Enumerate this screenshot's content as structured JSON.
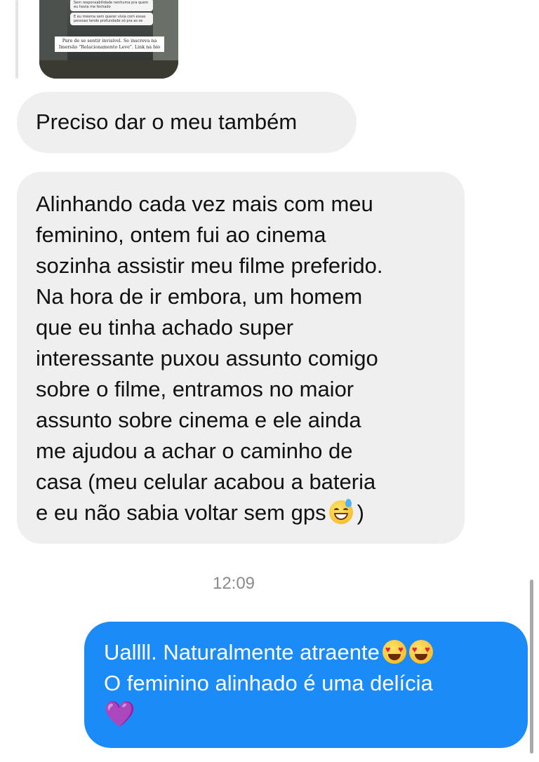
{
  "reply_preview": {
    "story_text_1": "Sem responsabilidade nenhuma pra quem eu havia me fechado",
    "story_text_2": "E eu mesma sem querer vivia com essas pessoas tendo profundade só pra as se",
    "caption": "Pare de se sentir invisível. Se inscreva na Imersão \"Relacionamento Leve\". Link na bio"
  },
  "messages": [
    {
      "sender": "them",
      "text": "Preciso dar o meu também"
    },
    {
      "sender": "them",
      "lines": [
        "Alinhando cada vez mais com meu",
        "feminino, ontem fui ao cinema",
        "sozinha assistir meu filme preferido.",
        "Na hora de ir embora, um homem",
        "que eu tinha achado super",
        "interessante puxou assunto comigo",
        "sobre o filme, entramos no maior",
        "assunto sobre cinema e ele ainda",
        "me ajudou a achar o caminho de",
        "casa (meu celular acabou a bateria",
        "e eu não sabia voltar sem gps"
      ],
      "tail_text": ")",
      "emoji": "grinning-face-with-sweat-icon"
    },
    {
      "sender": "me",
      "line1": "Uallll. Naturalmente atraente",
      "line2": "O feminino alinhado é uma delícia",
      "line3_emoji": "💜",
      "emojis": [
        "heart-eyes-icon",
        "heart-eyes-icon",
        "purple-heart-icon"
      ]
    }
  ],
  "timestamp": "12:09",
  "colors": {
    "incoming_bubble": "#efefef",
    "outgoing_bubble": "#1a8bf7",
    "timestamp": "#8a8a8e"
  }
}
